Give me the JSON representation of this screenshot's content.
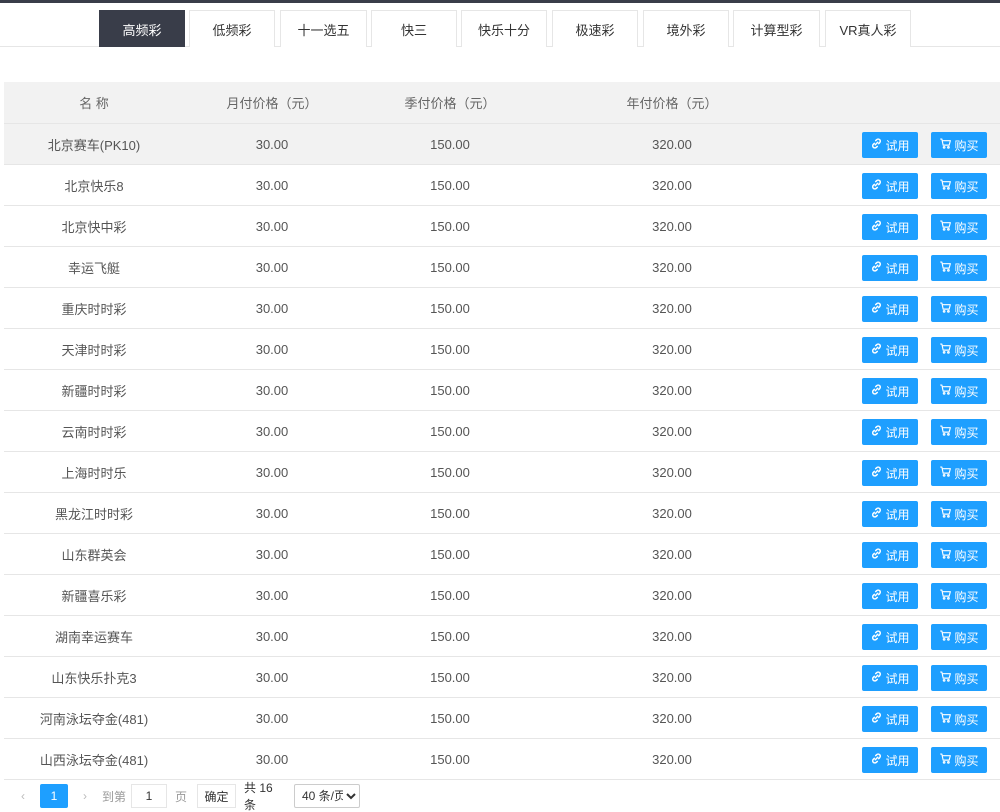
{
  "tabs": [
    {
      "label": "高频彩",
      "active": true
    },
    {
      "label": "低频彩",
      "active": false
    },
    {
      "label": "十一选五",
      "active": false
    },
    {
      "label": "快三",
      "active": false
    },
    {
      "label": "快乐十分",
      "active": false
    },
    {
      "label": "极速彩",
      "active": false
    },
    {
      "label": "境外彩",
      "active": false
    },
    {
      "label": "计算型彩",
      "active": false
    },
    {
      "label": "VR真人彩",
      "active": false
    }
  ],
  "table": {
    "headers": {
      "name": "名 称",
      "monthly": "月付价格（元）",
      "quarterly": "季付价格（元）",
      "yearly": "年付价格（元）"
    },
    "try_label": "试用",
    "buy_label": "购买",
    "rows": [
      {
        "name": "北京赛车(PK10)",
        "monthly": "30.00",
        "quarterly": "150.00",
        "yearly": "320.00"
      },
      {
        "name": "北京快乐8",
        "monthly": "30.00",
        "quarterly": "150.00",
        "yearly": "320.00"
      },
      {
        "name": "北京快中彩",
        "monthly": "30.00",
        "quarterly": "150.00",
        "yearly": "320.00"
      },
      {
        "name": "幸运飞艇",
        "monthly": "30.00",
        "quarterly": "150.00",
        "yearly": "320.00"
      },
      {
        "name": "重庆时时彩",
        "monthly": "30.00",
        "quarterly": "150.00",
        "yearly": "320.00"
      },
      {
        "name": "天津时时彩",
        "monthly": "30.00",
        "quarterly": "150.00",
        "yearly": "320.00"
      },
      {
        "name": "新疆时时彩",
        "monthly": "30.00",
        "quarterly": "150.00",
        "yearly": "320.00"
      },
      {
        "name": "云南时时彩",
        "monthly": "30.00",
        "quarterly": "150.00",
        "yearly": "320.00"
      },
      {
        "name": "上海时时乐",
        "monthly": "30.00",
        "quarterly": "150.00",
        "yearly": "320.00"
      },
      {
        "name": "黑龙江时时彩",
        "monthly": "30.00",
        "quarterly": "150.00",
        "yearly": "320.00"
      },
      {
        "name": "山东群英会",
        "monthly": "30.00",
        "quarterly": "150.00",
        "yearly": "320.00"
      },
      {
        "name": "新疆喜乐彩",
        "monthly": "30.00",
        "quarterly": "150.00",
        "yearly": "320.00"
      },
      {
        "name": "湖南幸运赛车",
        "monthly": "30.00",
        "quarterly": "150.00",
        "yearly": "320.00"
      },
      {
        "name": "山东快乐扑克3",
        "monthly": "30.00",
        "quarterly": "150.00",
        "yearly": "320.00"
      },
      {
        "name": "河南泳坛夺金(481)",
        "monthly": "30.00",
        "quarterly": "150.00",
        "yearly": "320.00"
      },
      {
        "name": "山西泳坛夺金(481)",
        "monthly": "30.00",
        "quarterly": "150.00",
        "yearly": "320.00"
      }
    ]
  },
  "pager": {
    "prev_icon": "chevron-left-icon",
    "current_page": "1",
    "next_icon": "chevron-right-icon",
    "goto_label": "到第",
    "goto_value": "1",
    "page_label": "页",
    "confirm_label": "确定",
    "total_label": "共 16 条",
    "page_size_selected": "40 条/页"
  },
  "colors": {
    "accent": "#1e9fff",
    "active_tab": "#393d49",
    "header_bg": "#f2f2f2"
  }
}
